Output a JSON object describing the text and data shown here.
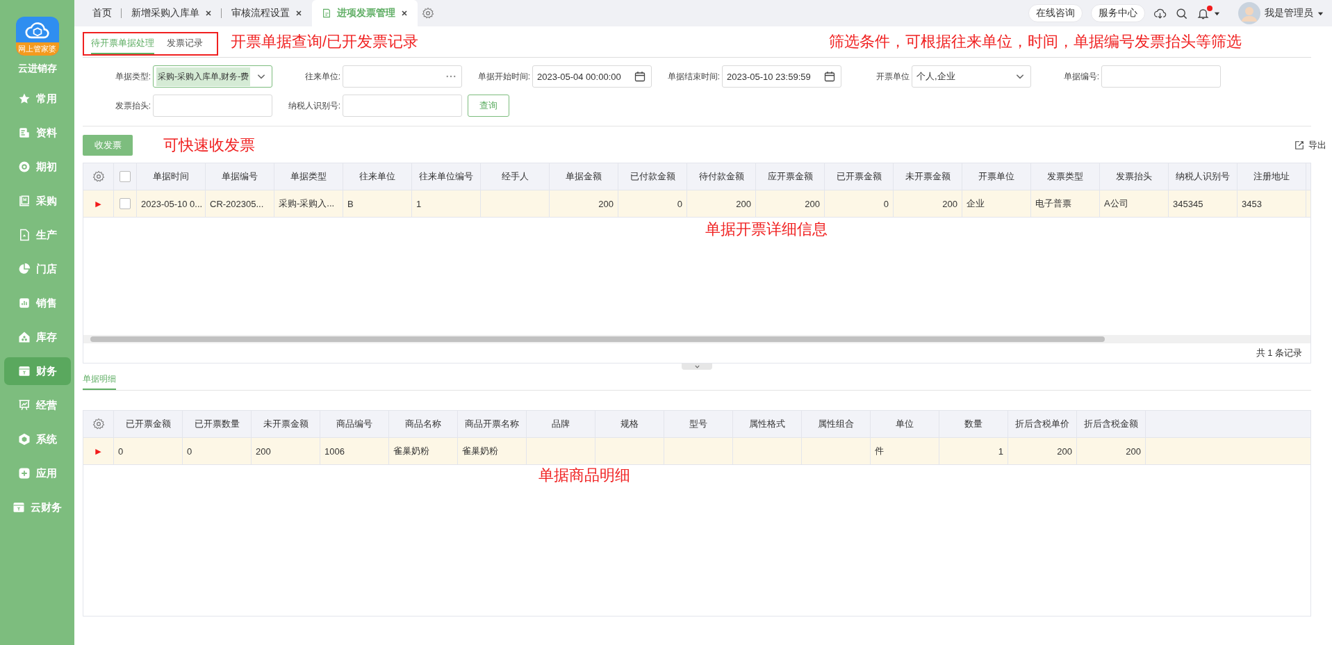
{
  "sidebar": {
    "logo_badge": "网上管家婆",
    "app_name": "云进销存",
    "items": [
      {
        "label": "常用",
        "selected": false
      },
      {
        "label": "资料",
        "selected": false
      },
      {
        "label": "期初",
        "selected": false
      },
      {
        "label": "采购",
        "selected": false
      },
      {
        "label": "生产",
        "selected": false
      },
      {
        "label": "门店",
        "selected": false
      },
      {
        "label": "销售",
        "selected": false
      },
      {
        "label": "库存",
        "selected": false
      },
      {
        "label": "财务",
        "selected": true
      },
      {
        "label": "经营",
        "selected": false
      },
      {
        "label": "系统",
        "selected": false
      },
      {
        "label": "应用",
        "selected": false
      },
      {
        "label": "云财务",
        "selected": false
      }
    ]
  },
  "tabs": [
    {
      "label": "首页",
      "selected": false,
      "closable": false
    },
    {
      "label": "新增采购入库单",
      "selected": false,
      "closable": true
    },
    {
      "label": "审核流程设置",
      "selected": false,
      "closable": true
    },
    {
      "label": "进项发票管理",
      "selected": true,
      "closable": true
    }
  ],
  "header": {
    "buttons": [
      "在线咨询",
      "服务中心"
    ],
    "unread_notifications": true,
    "user_name": "我是管理员"
  },
  "subtabs": [
    {
      "label": "待开票单据处理",
      "selected": true
    },
    {
      "label": "发票记录",
      "selected": false
    }
  ],
  "subtabs_annotation": "开票单据查询/已开发票记录",
  "filters_annotation": "筛选条件，可根据往来单位，时间，单据编号发票抬头等筛选",
  "filters": [
    {
      "kind": "select",
      "label": "单据类型:",
      "value": "采购-采购入库单,财务-费"
    },
    {
      "kind": "picker",
      "label": "往来单位:"
    },
    {
      "kind": "datetime",
      "label": "单据开始时间:",
      "value": "2023-05-04 00:00:00"
    },
    {
      "kind": "datetime",
      "label": "单据结束时间:",
      "value": "2023-05-10 23:59:59"
    },
    {
      "kind": "dropdown",
      "label": "开票单位",
      "value": "个人,企业"
    },
    {
      "kind": "text",
      "label": "单据编号:"
    },
    {
      "kind": "text",
      "label": "发票抬头:"
    },
    {
      "kind": "text",
      "label": "纳税人识别号:"
    },
    {
      "kind": "button",
      "label": "查询"
    }
  ],
  "toolbar": {
    "button": "收发票",
    "annotation": "可快速收发票",
    "export": "导出"
  },
  "table": {
    "select_all_checked": false,
    "columns": [
      {
        "label": "单据时间",
        "kind": "text"
      },
      {
        "label": "单据编号",
        "kind": "text"
      },
      {
        "label": "单据类型",
        "kind": "text"
      },
      {
        "label": "往来单位",
        "kind": "text"
      },
      {
        "label": "往来单位编号",
        "kind": "text"
      },
      {
        "label": "经手人",
        "kind": "text"
      },
      {
        "label": "单据金额",
        "kind": "amount"
      },
      {
        "label": "已付款金额",
        "kind": "amount"
      },
      {
        "label": "待付款金额",
        "kind": "amount"
      },
      {
        "label": "应开票金额",
        "kind": "amount"
      },
      {
        "label": "已开票金额",
        "kind": "amount"
      },
      {
        "label": "未开票金额",
        "kind": "amount"
      },
      {
        "label": "开票单位",
        "kind": "text"
      },
      {
        "label": "发票类型",
        "kind": "text"
      },
      {
        "label": "发票抬头",
        "kind": "text"
      },
      {
        "label": "纳税人识别号",
        "kind": "text"
      },
      {
        "label": "注册地址",
        "kind": "text"
      }
    ],
    "rows": [
      {
        "marker": "▶",
        "checked": false,
        "cells": [
          "2023-05-10 0...",
          "CR-202305...",
          "采购-采购入...",
          "B",
          "1",
          null,
          "200",
          "0",
          "200",
          "200",
          "0",
          "200",
          "企业",
          "电子普票",
          "A公司",
          "345345",
          "3453"
        ]
      }
    ],
    "annotation": "单据开票详细信息",
    "footer": "共 1 条记录"
  },
  "detail_tabs": [
    {
      "label": "单据明细",
      "selected": true
    }
  ],
  "detail_table": {
    "columns": [
      {
        "label": "已开票金额",
        "kind": "text"
      },
      {
        "label": "已开票数量",
        "kind": "text"
      },
      {
        "label": "未开票金额",
        "kind": "text"
      },
      {
        "label": "商品编号",
        "kind": "text"
      },
      {
        "label": "商品名称",
        "kind": "text"
      },
      {
        "label": "商品开票名称",
        "kind": "text"
      },
      {
        "label": "品牌",
        "kind": "text"
      },
      {
        "label": "规格",
        "kind": "text"
      },
      {
        "label": "型号",
        "kind": "text"
      },
      {
        "label": "属性格式",
        "kind": "text"
      },
      {
        "label": "属性组合",
        "kind": "text"
      },
      {
        "label": "单位",
        "kind": "text"
      },
      {
        "label": "数量",
        "kind": "amount"
      },
      {
        "label": "折后含税单价",
        "kind": "amount"
      },
      {
        "label": "折后含税金额",
        "kind": "amount"
      }
    ],
    "rows": [
      {
        "marker": "▶",
        "cells": [
          "0",
          "0",
          "200",
          "1006",
          "雀巢奶粉",
          "雀巢奶粉",
          null,
          null,
          null,
          null,
          null,
          "件",
          "1",
          "200",
          "200"
        ]
      }
    ],
    "annotation": "单据商品明细"
  }
}
